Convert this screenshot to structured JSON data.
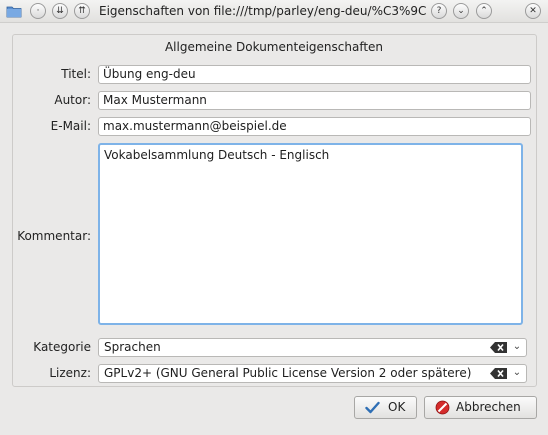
{
  "window": {
    "title": "Eigenschaften von file:///tmp/parley/eng-deu/%C3%9Cb..."
  },
  "titlebar_buttons": {
    "help": "?",
    "minimize": "⌄",
    "maximize": "⌃",
    "close": "✕"
  },
  "section": {
    "title": "Allgemeine Dokumenteigenschaften"
  },
  "form": {
    "title_label": "Titel:",
    "title_value": "Übung eng-deu",
    "author_label": "Autor:",
    "author_value": "Max Mustermann",
    "email_label": "E-Mail:",
    "email_value": "max.mustermann@beispiel.de",
    "comment_label": "Kommentar:",
    "comment_value": "Vokabelsammlung Deutsch - Englisch",
    "category_label": "Kategorie",
    "category_value": "Sprachen",
    "license_label": "Lizenz:",
    "license_value": "GPLv2+ (GNU General Public License Version 2 oder spätere)"
  },
  "buttons": {
    "ok": "OK",
    "cancel": "Abbrechen"
  },
  "colors": {
    "focus_border": "#7eb3e8",
    "ok_check": "#2f6fb5",
    "cancel_red": "#d42b2b"
  }
}
